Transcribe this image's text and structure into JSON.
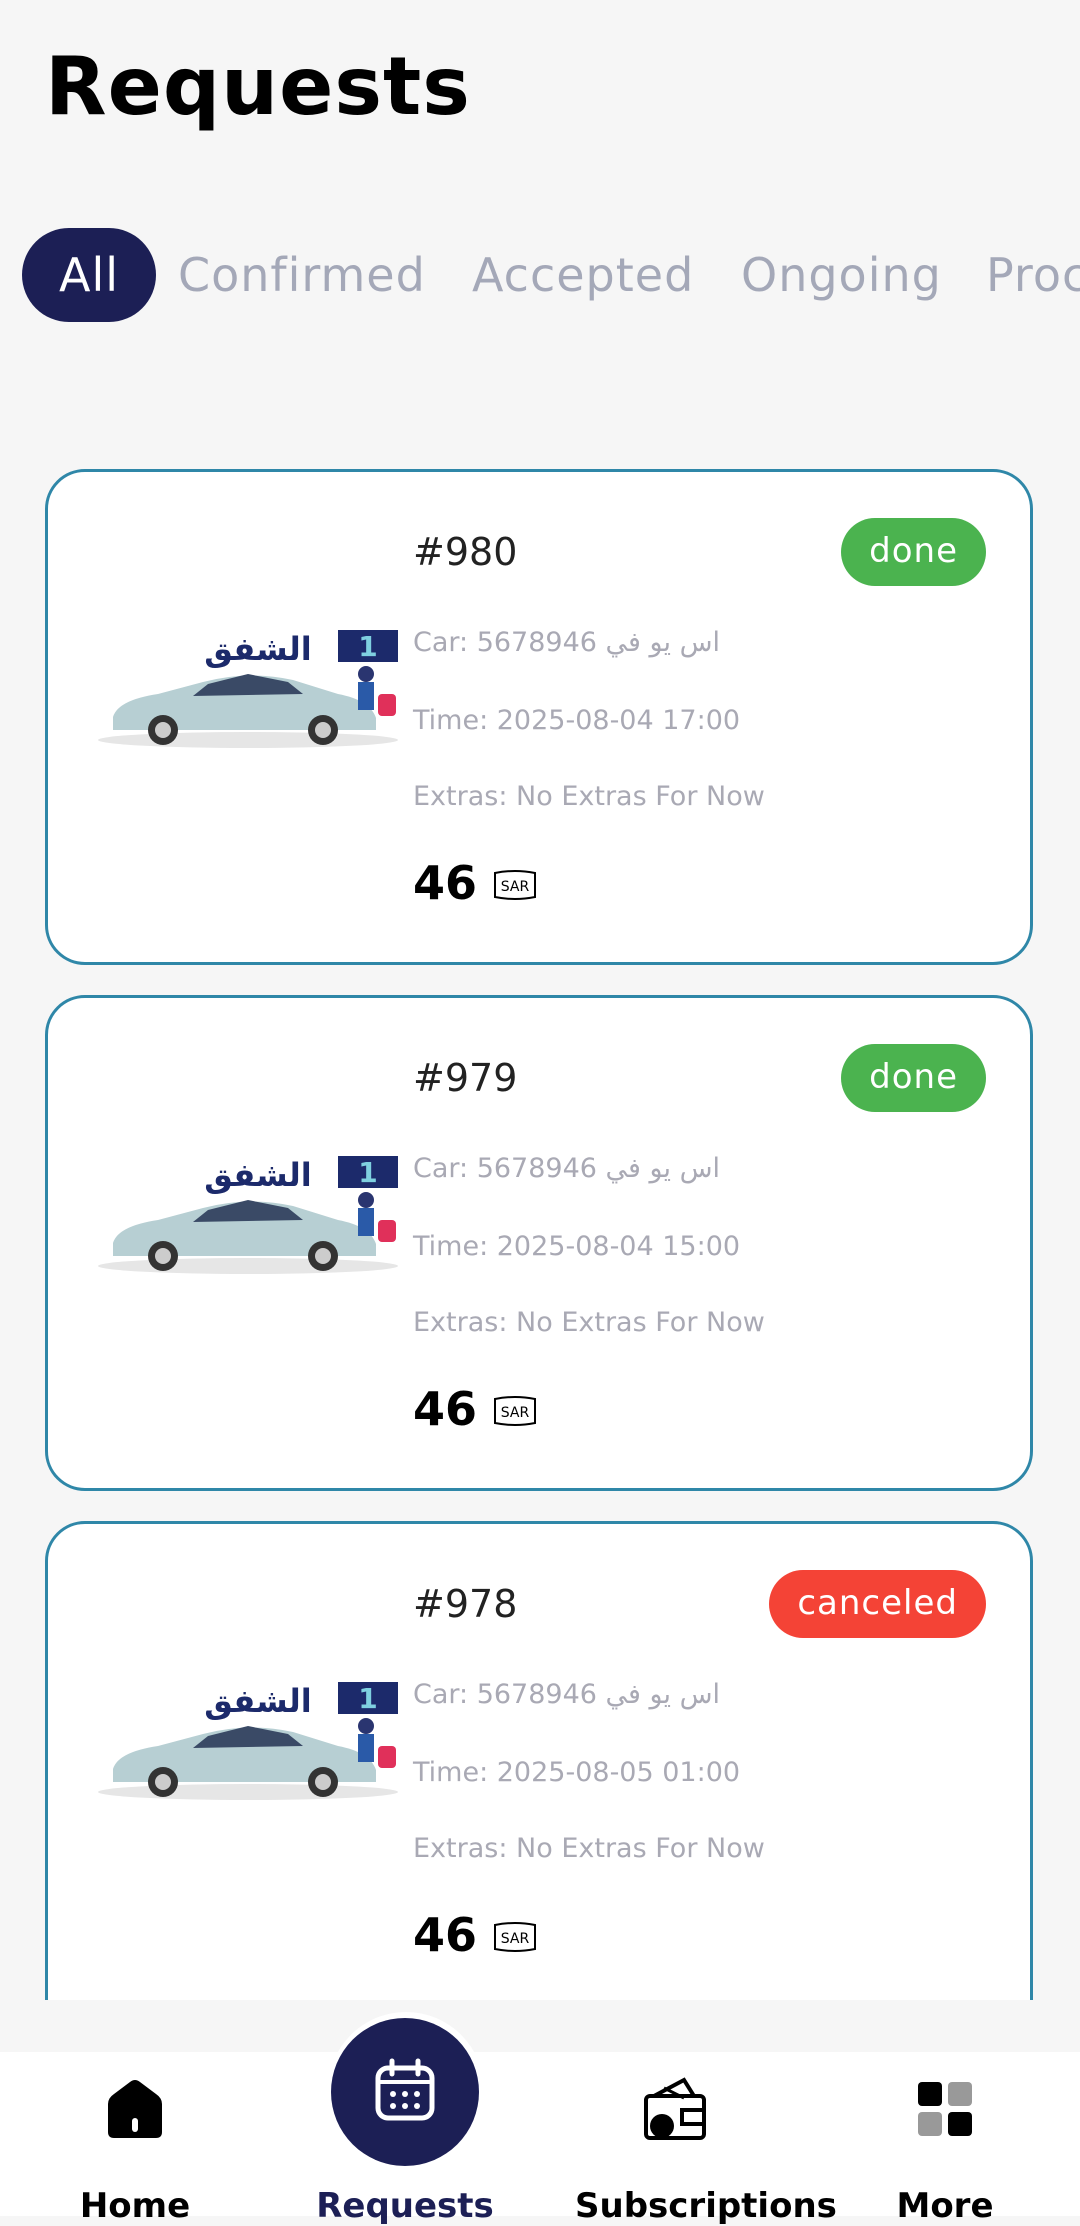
{
  "page": {
    "title": "Requests"
  },
  "tabs": [
    "All",
    "Confirmed",
    "Accepted",
    "Ongoing",
    "Proc"
  ],
  "requests": [
    {
      "id": "#980",
      "status": "done",
      "car": "Car: 5678946 اس يو في",
      "time": "Time: 2025-08-04 17:00",
      "extras": "Extras: No Extras For Now",
      "price": "46",
      "currency": "SAR"
    },
    {
      "id": "#979",
      "status": "done",
      "car": "Car: 5678946 اس يو في",
      "time": "Time: 2025-08-04 15:00",
      "extras": "Extras: No Extras For Now",
      "price": "46",
      "currency": "SAR"
    },
    {
      "id": "#978",
      "status": "canceled",
      "car": "Car: 5678946 اس يو في",
      "time": "Time: 2025-08-05 01:00",
      "extras": "Extras: No Extras For Now",
      "price": "46",
      "currency": "SAR"
    }
  ],
  "nav": {
    "home": "Home",
    "requests": "Requests",
    "subscriptions": "Subscriptions",
    "more": "More"
  },
  "colors": {
    "primary": "#1c1f55",
    "done": "#4bb34f",
    "canceled": "#f44336",
    "card_border": "#2f87a8"
  },
  "icons": {
    "home": "home-icon",
    "requests": "calendar-icon",
    "subscriptions": "wallet-icon",
    "more": "grid-icon",
    "currency": "sar-currency-icon"
  }
}
